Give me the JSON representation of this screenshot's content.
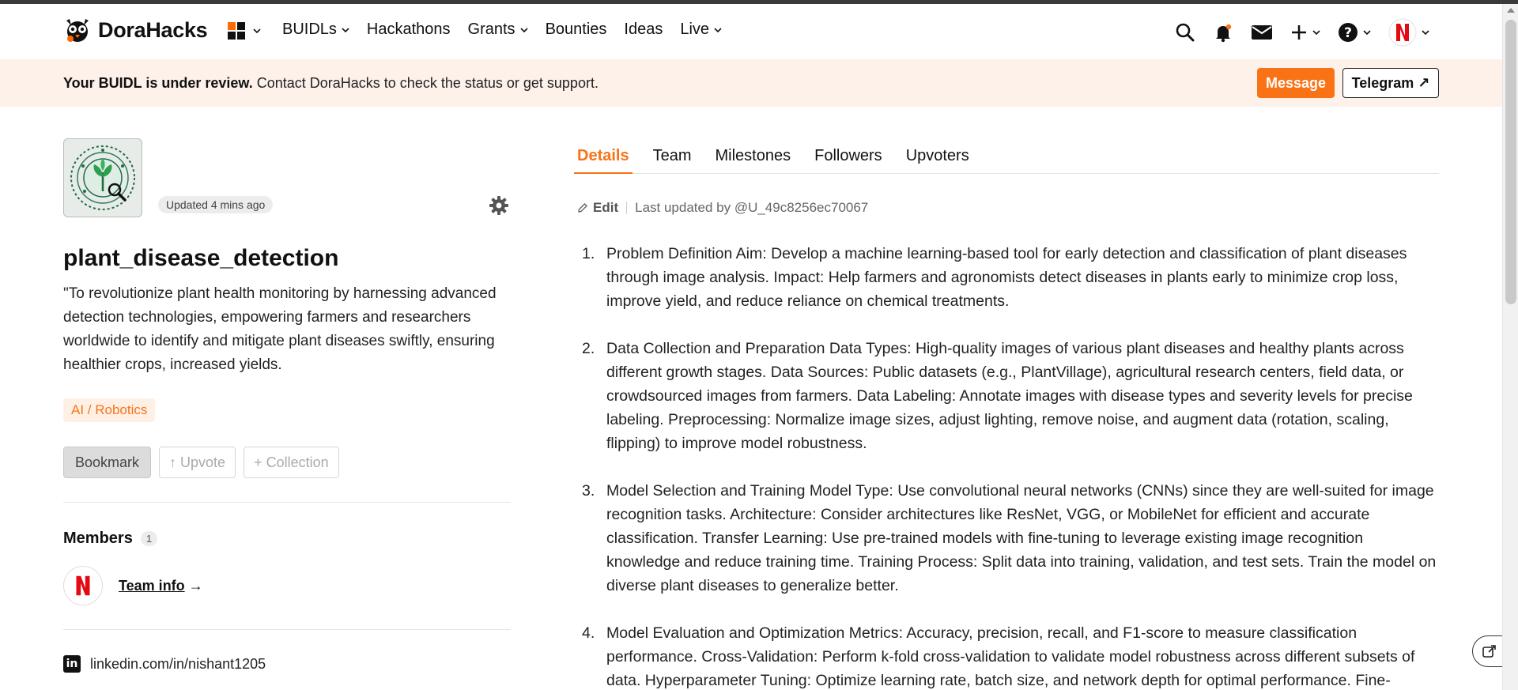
{
  "header": {
    "brand": "DoraHacks",
    "nav": [
      {
        "label": "BUIDLs",
        "has_dropdown": true
      },
      {
        "label": "Hackathons",
        "has_dropdown": false
      },
      {
        "label": "Grants",
        "has_dropdown": true
      },
      {
        "label": "Bounties",
        "has_dropdown": false
      },
      {
        "label": "Ideas",
        "has_dropdown": false
      },
      {
        "label": "Live",
        "has_dropdown": true
      }
    ],
    "icons": [
      "apps-grid-icon",
      "search-icon",
      "bell-icon",
      "mail-icon",
      "plus-icon",
      "help-icon",
      "user-avatar"
    ]
  },
  "banner": {
    "bold": "Your BUIDL is under review.",
    "text": " Contact DoraHacks to check the status or get support.",
    "message_button": "Message",
    "telegram_button": "Telegram ↗"
  },
  "project": {
    "updated": "Updated 4 mins ago",
    "title": "plant_disease_detection",
    "description": "\"To revolutionize plant health monitoring by harnessing advanced detection technologies, empowering farmers and researchers worldwide to identify and mitigate plant diseases swiftly, ensuring healthier crops, increased yields.",
    "tag": "AI / Robotics",
    "bookmark": "Bookmark",
    "upvote": "↑ Upvote",
    "collection": "+ Collection"
  },
  "members": {
    "heading": "Members",
    "count": "1",
    "team_info": "Team info",
    "arrow": "→"
  },
  "links": {
    "linkedin": "linkedin.com/in/nishant1205"
  },
  "tabs": [
    "Details",
    "Team",
    "Milestones",
    "Followers",
    "Upvoters"
  ],
  "details": {
    "edit": "Edit",
    "last_updated": "Last updated by @U_49c8256ec70067",
    "items": [
      {
        "num": "1.",
        "text": "Problem Definition Aim: Develop a machine learning-based tool for early detection and classification of plant diseases through image analysis. Impact: Help farmers and agronomists detect diseases in plants early to minimize crop loss, improve yield, and reduce reliance on chemical treatments."
      },
      {
        "num": "2.",
        "text": "Data Collection and Preparation Data Types: High-quality images of various plant diseases and healthy plants across different growth stages. Data Sources: Public datasets (e.g., PlantVillage), agricultural research centers, field data, or crowdsourced images from farmers. Data Labeling: Annotate images with disease types and severity levels for precise labeling. Preprocessing: Normalize image sizes, adjust lighting, remove noise, and augment data (rotation, scaling, flipping) to improve model robustness."
      },
      {
        "num": "3.",
        "text": "Model Selection and Training Model Type: Use convolutional neural networks (CNNs) since they are well-suited for image recognition tasks. Architecture: Consider architectures like ResNet, VGG, or MobileNet for efficient and accurate classification. Transfer Learning: Use pre-trained models with fine-tuning to leverage existing image recognition knowledge and reduce training time. Training Process: Split data into training, validation, and test sets. Train the model on diverse plant diseases to generalize better."
      },
      {
        "num": "4.",
        "text": "Model Evaluation and Optimization Metrics: Accuracy, precision, recall, and F1-score to measure classification performance. Cross-Validation: Perform k-fold cross-validation to validate model robustness across different subsets of data. Hyperparameter Tuning: Optimize learning rate, batch size, and network depth for optimal performance. Fine-"
      }
    ]
  },
  "colors": {
    "accent": "#f97316",
    "banner_bg": "#fdf1ea",
    "netflix_red": "#e50914"
  }
}
